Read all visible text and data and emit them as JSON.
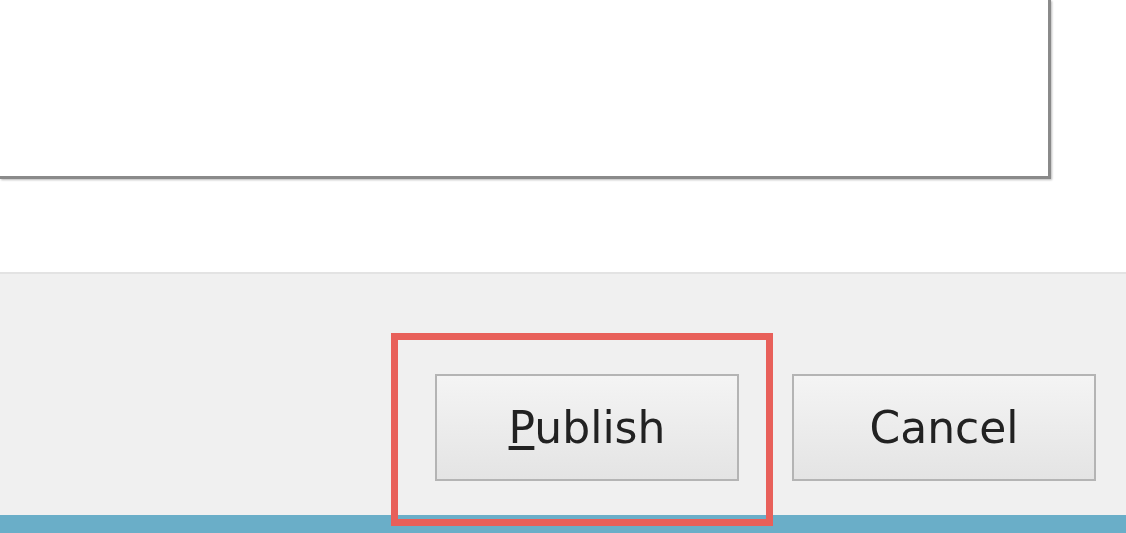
{
  "text_box": {
    "kind": "multiline"
  },
  "buttons": [
    {
      "label": "Publish",
      "access_key_underlined": true,
      "highlighted": true
    },
    {
      "label": "Cancel",
      "access_key_underlined": false,
      "highlighted": false
    }
  ]
}
